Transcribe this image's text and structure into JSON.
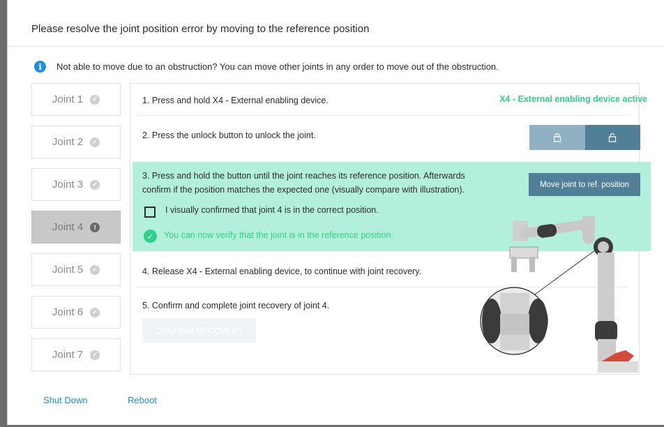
{
  "dialog": {
    "title": "Please resolve the joint position error by moving to the reference position",
    "info_icon": "i",
    "info": "Not able to move due to an obstruction? You can move other joints in any order to move out of the obstruction."
  },
  "joints": [
    {
      "label": "Joint 1",
      "status": "check-icon"
    },
    {
      "label": "Joint 2",
      "status": "check-icon"
    },
    {
      "label": "Joint 3",
      "status": "check-icon"
    },
    {
      "label": "Joint 4",
      "status": "alert-icon",
      "selected": true
    },
    {
      "label": "Joint 5",
      "status": "check-icon"
    },
    {
      "label": "Joint 6",
      "status": "check-icon"
    },
    {
      "label": "Joint 7",
      "status": "check-icon"
    }
  ],
  "steps": {
    "step1": "1. Press and hold X4 - External enabling device.",
    "step1_status": "X4 - External enabling device active",
    "step2": "2. Press the unlock button to unlock the joint.",
    "lock_icon": "lock-icon",
    "unlock_icon": "unlock-icon",
    "step3_line1": "3. Press and hold the button until the joint reaches its reference position. Afterwards",
    "step3_line2": "confirm if the position matches the expected one (visually compare with illustration).",
    "move_button": "Move joint to ref. position",
    "checkbox_label": "I visually confirmed that joint 4 is in the correct position.",
    "success_text": "You can now verify that the joint is in the reference position.",
    "step4": "4. Release X4 - External enabling device, to continue with joint recovery.",
    "step5": "5. Confirm and complete joint recovery of joint 4.",
    "confirm_button": "CONFIRM RECOVERY"
  },
  "footer": {
    "shutdown": "Shut Down",
    "reboot": "Reboot"
  },
  "colors": {
    "accent": "#1c8fd8",
    "success": "#2ed18a",
    "highlight": "#b3f0dc",
    "button": "#527f98"
  }
}
